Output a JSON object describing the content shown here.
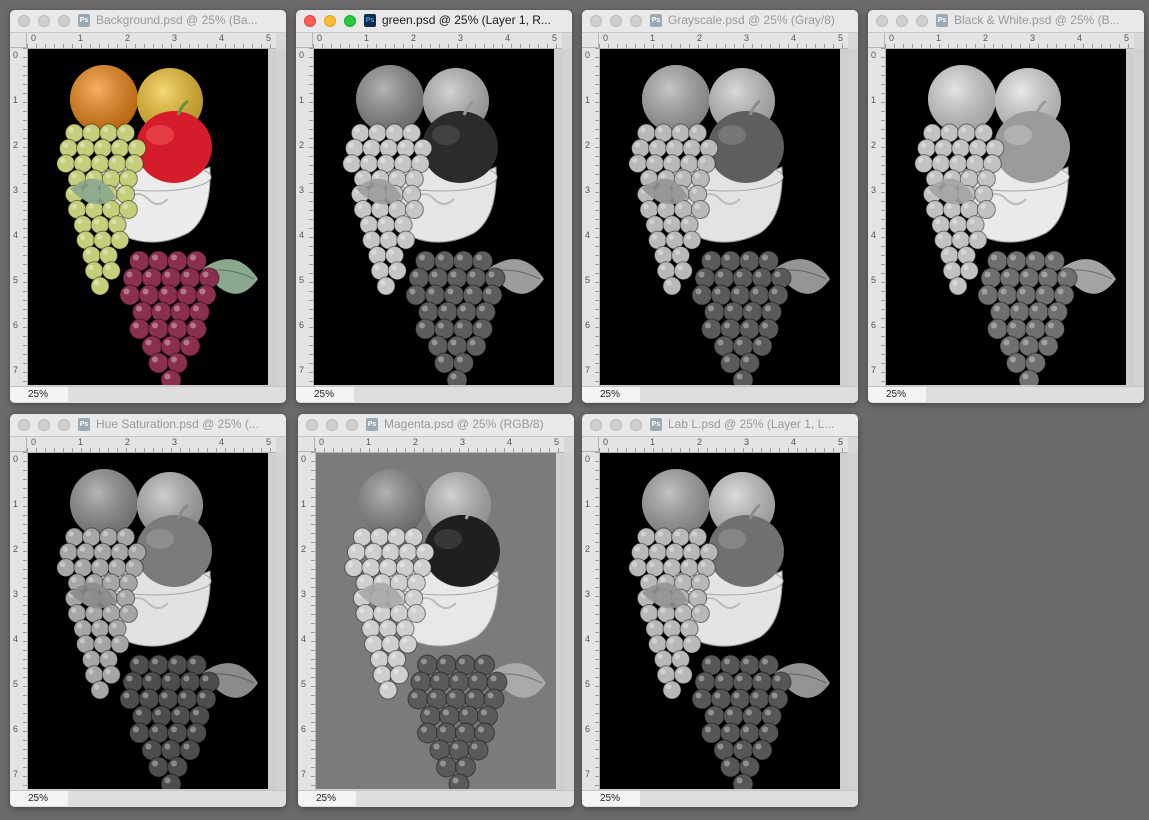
{
  "windows": [
    {
      "title": "Background.psd @ 25% (Ba...",
      "zoom": "25%",
      "active": false,
      "mode": "color",
      "bg": "black"
    },
    {
      "title": "green.psd @ 25% (Layer 1, R...",
      "zoom": "25%",
      "active": true,
      "mode": "green",
      "bg": "black"
    },
    {
      "title": "Grayscale.psd @ 25% (Gray/8)",
      "zoom": "25%",
      "active": false,
      "mode": "gray",
      "bg": "black"
    },
    {
      "title": "Black & White.psd @ 25% (B...",
      "zoom": "25%",
      "active": false,
      "mode": "bw",
      "bg": "black"
    },
    {
      "title": "Hue Saturation.psd @ 25% (...",
      "zoom": "25%",
      "active": false,
      "mode": "hue",
      "bg": "black"
    },
    {
      "title": "Magenta.psd @ 25% (RGB/8)",
      "zoom": "25%",
      "active": false,
      "mode": "magenta",
      "bg": "gray"
    },
    {
      "title": "Lab L.psd @ 25% (Layer 1, L...",
      "zoom": "25%",
      "active": false,
      "mode": "lab",
      "bg": "black"
    }
  ],
  "ruler": {
    "h": [
      "0",
      "1",
      "2",
      "3",
      "4",
      "5"
    ],
    "v": [
      "0",
      "1",
      "2",
      "3",
      "4",
      "5",
      "6",
      "7"
    ]
  },
  "palettes": {
    "color": {
      "orange": "#f2860f",
      "yellow": "#f3c32a",
      "apple": "#d51c2a",
      "applehi": "#f05a5a",
      "grape": "#c5ce7a",
      "purple": "#8a2f4f",
      "leaf": "#8aa88e",
      "bowl": "#ececec",
      "stem": "#6c8f3a"
    },
    "green": {
      "orange": "#8c8c8c",
      "yellow": "#bdbdbd",
      "apple": "#2b2b2b",
      "applehi": "#555555",
      "grape": "#c6c6c6",
      "purple": "#5d5d5d",
      "leaf": "#9c9c9c",
      "bowl": "#e6e6e6",
      "stem": "#9a9a9a"
    },
    "gray": {
      "orange": "#a9a9a9",
      "yellow": "#c7c7c7",
      "apple": "#5e5e5e",
      "applehi": "#8a8a8a",
      "grape": "#b9b9b9",
      "purple": "#5a5a5a",
      "leaf": "#959595",
      "bowl": "#e3e3e3",
      "stem": "#8b8b8b"
    },
    "bw": {
      "orange": "#d7d7d7",
      "yellow": "#dedede",
      "apple": "#9b9b9b",
      "applehi": "#c2c2c2",
      "grape": "#c2c2c2",
      "purple": "#6f6f6f",
      "leaf": "#a4a4a4",
      "bowl": "#eaeaea",
      "stem": "#9a9a9a"
    },
    "hue": {
      "orange": "#8f8f8f",
      "yellow": "#b5b5b5",
      "apple": "#7a7a7a",
      "applehi": "#9e9e9e",
      "grape": "#a6a6a6",
      "purple": "#4d4d4d",
      "leaf": "#8b8b8b",
      "bowl": "#e2e2e2",
      "stem": "#8a8a8a"
    },
    "magenta": {
      "orange": "#898989",
      "yellow": "#bbbbbb",
      "apple": "#1f1f1f",
      "applehi": "#4a4a4a",
      "grape": "#cfcfcf",
      "purple": "#5a5a5a",
      "leaf": "#a9a9a9",
      "bowl": "#e8e8e8",
      "stem": "#a7a7a7"
    },
    "lab": {
      "orange": "#a3a3a3",
      "yellow": "#cacaca",
      "apple": "#707070",
      "applehi": "#999999",
      "grape": "#b8b8b8",
      "purple": "#565656",
      "leaf": "#939393",
      "bowl": "#e4e4e4",
      "stem": "#8c8c8c"
    }
  },
  "canvas_bg": {
    "black": "#000000",
    "gray": "#7b7b7b"
  }
}
